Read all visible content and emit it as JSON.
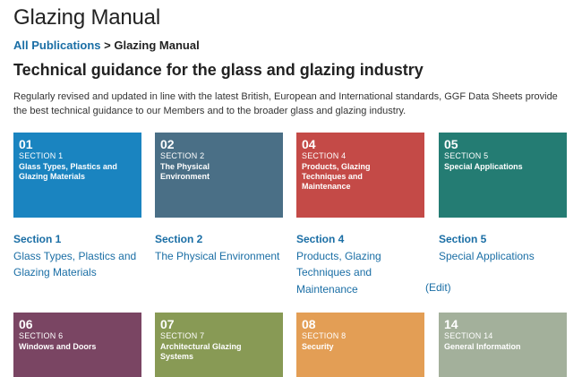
{
  "page": {
    "title": "Glazing Manual",
    "subtitle": "Technical guidance for the glass and glazing industry",
    "intro": "Regularly revised and updated in line with the latest British, European and International standards, GGF Data Sheets provide the best technical guidance to our Members and to the broader glass and glazing industry."
  },
  "breadcrumb": {
    "link": "All Publications",
    "separator": " > ",
    "current": "Glazing Manual"
  },
  "tiles": [
    {
      "num": "01",
      "section": "SECTION 1",
      "name": "Glass Types, Plastics and Glazing Materials",
      "color": "#1a84c0"
    },
    {
      "num": "02",
      "section": "SECTION 2",
      "name": "The Physical Environment",
      "color": "#4a6f86"
    },
    {
      "num": "04",
      "section": "SECTION 4",
      "name": "Products, Glazing Techniques and Maintenance",
      "color": "#c44a47"
    },
    {
      "num": "05",
      "section": "SECTION 5",
      "name": "Special Applications",
      "color": "#247c73"
    },
    {
      "num": "06",
      "section": "SECTION 6",
      "name": "Windows and Doors",
      "color": "#7a4563"
    },
    {
      "num": "07",
      "section": "SECTION 7",
      "name": "Architectural Glazing Systems",
      "color": "#889a55"
    },
    {
      "num": "08",
      "section": "SECTION 8",
      "name": "Security",
      "color": "#e39e55"
    },
    {
      "num": "14",
      "section": "SECTION 14",
      "name": "General Information",
      "color": "#a3b09b"
    }
  ],
  "section_links": [
    {
      "heading": "Section 1",
      "lines": [
        "Glass Types, Plastics and",
        "Glazing Materials"
      ]
    },
    {
      "heading": "Section 2",
      "lines": [
        "The Physical Environment"
      ]
    },
    {
      "heading": "Section 4",
      "lines": [
        "Products, Glazing",
        "Techniques and",
        "Maintenance"
      ]
    },
    {
      "heading": "Section 5",
      "lines": [
        "Special Applications"
      ]
    }
  ],
  "edit_label": "(Edit)",
  "colors": {
    "link": "#1a6ea5"
  }
}
